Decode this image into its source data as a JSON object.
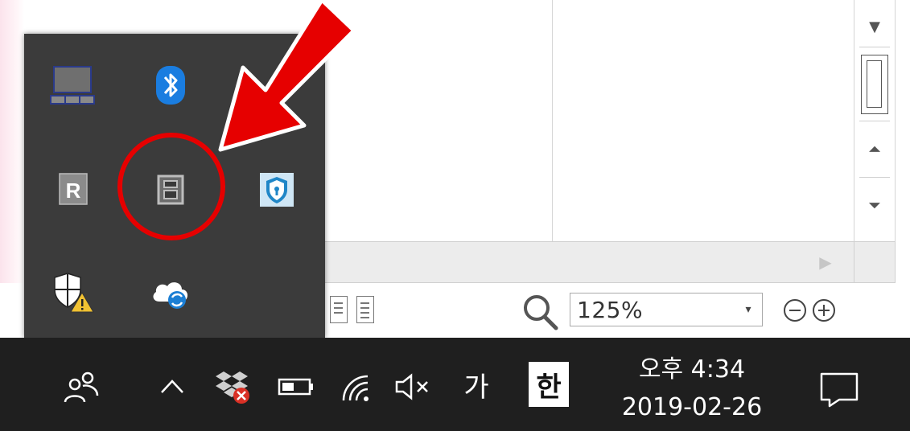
{
  "statusbar": {
    "zoom_value": "125%"
  },
  "taskbar": {
    "ime_mode": "가",
    "ime_lang": "한",
    "clock_time": "오후 4:34",
    "clock_date": "2019-02-26"
  },
  "tray_popup": {
    "items": [
      {
        "name": "laptop-display-icon"
      },
      {
        "name": "bluetooth-icon"
      },
      {
        "name": "r-app-icon"
      },
      {
        "name": "window-app-icon"
      },
      {
        "name": "security-shield-icon"
      },
      {
        "name": "windows-security-warning-icon"
      },
      {
        "name": "cloud-sync-icon"
      }
    ]
  },
  "colors": {
    "taskbar_bg": "#1f1f1f",
    "popup_bg": "#3b3b3b",
    "annotation_red": "#e60000",
    "bluetooth_blue": "#1a7de0"
  }
}
